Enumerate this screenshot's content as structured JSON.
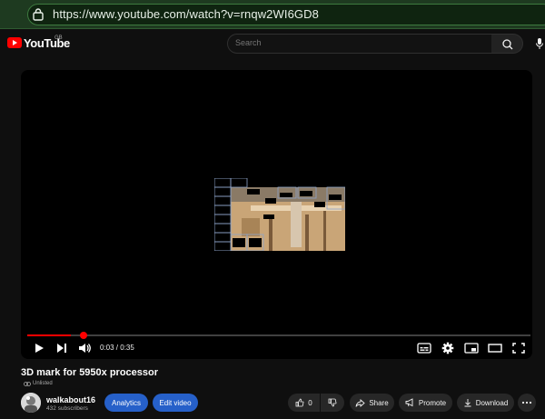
{
  "browser": {
    "url": "https://www.youtube.com/watch?v=rnqw2WI6GD8"
  },
  "header": {
    "wordmark": "YouTube",
    "region": "GB",
    "search_placeholder": "Search"
  },
  "player": {
    "time": "0:03 / 0:35",
    "progress": 0.086
  },
  "video": {
    "title": "3D mark for 5950x processor",
    "visibility": "Unlisted"
  },
  "channel": {
    "name": "walkabout16",
    "subscribers": "432 subscribers"
  },
  "actions": {
    "analytics": "Analytics",
    "edit_video": "Edit video",
    "likes": "0",
    "share": "Share",
    "promote": "Promote",
    "download": "Download"
  },
  "colors": {
    "accent": "#ff0000",
    "blue_button": "#2660c9",
    "browser_bar": "#1e3a20"
  }
}
